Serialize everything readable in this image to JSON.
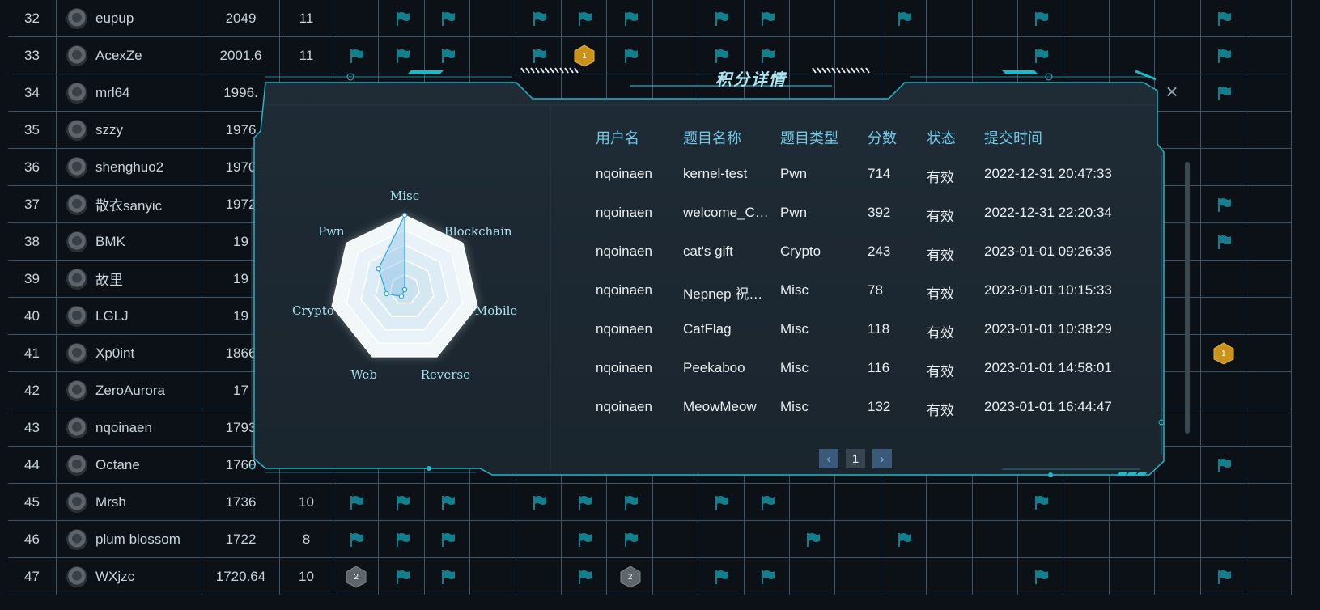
{
  "scoreboard": {
    "rows": [
      {
        "rank": "32",
        "name": "eupup",
        "score": "2049",
        "solved": "11",
        "flags": [
          1,
          2,
          4,
          5,
          6,
          8,
          9,
          12,
          15,
          19
        ]
      },
      {
        "rank": "33",
        "name": "AcexZe",
        "score": "2001.6",
        "solved": "11",
        "flags": [
          0,
          1,
          2,
          4,
          6,
          8,
          9,
          15,
          19
        ],
        "badges": [
          {
            "col": 5,
            "label": "1",
            "color": "gold"
          }
        ]
      },
      {
        "rank": "34",
        "name": "mrl64",
        "score": "1996.",
        "solved": "",
        "flags": [
          19
        ]
      },
      {
        "rank": "35",
        "name": "szzy",
        "score": "1976",
        "solved": "",
        "flags": []
      },
      {
        "rank": "36",
        "name": "shenghuo2",
        "score": "1970",
        "solved": "",
        "flags": []
      },
      {
        "rank": "37",
        "name": "散衣sanyic",
        "score": "1972",
        "solved": "",
        "flags": [
          19
        ]
      },
      {
        "rank": "38",
        "name": "BMK",
        "score": "19",
        "solved": "",
        "flags": [
          19
        ]
      },
      {
        "rank": "39",
        "name": "故里",
        "score": "19",
        "solved": "",
        "flags": []
      },
      {
        "rank": "40",
        "name": "LGLJ",
        "score": "19",
        "solved": "",
        "flags": []
      },
      {
        "rank": "41",
        "name": "Xp0int",
        "score": "1866",
        "solved": "",
        "flags": [],
        "badges": [
          {
            "col": 19,
            "label": "1",
            "color": "gold"
          }
        ]
      },
      {
        "rank": "42",
        "name": "ZeroAurora",
        "score": "17",
        "solved": "",
        "flags": []
      },
      {
        "rank": "43",
        "name": "nqoinaen",
        "score": "1793",
        "solved": "",
        "flags": []
      },
      {
        "rank": "44",
        "name": "Octane",
        "score": "1760",
        "solved": "",
        "flags": [
          19
        ]
      },
      {
        "rank": "45",
        "name": "Mrsh",
        "score": "1736",
        "solved": "10",
        "flags": [
          0,
          1,
          2,
          4,
          5,
          6,
          8,
          9,
          15
        ]
      },
      {
        "rank": "46",
        "name": "plum blossom",
        "score": "1722",
        "solved": "8",
        "flags": [
          0,
          1,
          2,
          5,
          6,
          10,
          12
        ]
      },
      {
        "rank": "47",
        "name": "WXjzc",
        "score": "1720.64",
        "solved": "10",
        "flags": [
          1,
          2,
          5,
          8,
          9,
          15,
          19
        ],
        "badges": [
          {
            "col": 0,
            "label": "2",
            "color": "gray"
          },
          {
            "col": 6,
            "label": "2",
            "color": "gray"
          }
        ]
      }
    ]
  },
  "modal": {
    "title": "积分详情",
    "close_icon": "×",
    "radar": {
      "axes": [
        "Misc",
        "Blockchain",
        "Mobile",
        "Reverse",
        "Web",
        "Crypto",
        "Pwn"
      ],
      "values": [
        1.0,
        0.0,
        0.0,
        0.0,
        0.1,
        0.25,
        0.45
      ]
    },
    "table": {
      "headers": [
        "用户名",
        "题目名称",
        "题目类型",
        "分数",
        "状态",
        "提交时间"
      ],
      "rows": [
        {
          "user": "nqoinaen",
          "challenge": "kernel-test",
          "type": "Pwn",
          "score": "714",
          "status": "有效",
          "time": "2022-12-31 20:47:33"
        },
        {
          "user": "nqoinaen",
          "challenge": "welcome_C…",
          "type": "Pwn",
          "score": "392",
          "status": "有效",
          "time": "2022-12-31 22:20:34"
        },
        {
          "user": "nqoinaen",
          "challenge": "cat's gift",
          "type": "Crypto",
          "score": "243",
          "status": "有效",
          "time": "2023-01-01 09:26:36"
        },
        {
          "user": "nqoinaen",
          "challenge": "Nepnep 祝…",
          "type": "Misc",
          "score": "78",
          "status": "有效",
          "time": "2023-01-01 10:15:33"
        },
        {
          "user": "nqoinaen",
          "challenge": "CatFlag",
          "type": "Misc",
          "score": "118",
          "status": "有效",
          "time": "2023-01-01 10:38:29"
        },
        {
          "user": "nqoinaen",
          "challenge": "Peekaboo",
          "type": "Misc",
          "score": "116",
          "status": "有效",
          "time": "2023-01-01 14:58:01"
        },
        {
          "user": "nqoinaen",
          "challenge": "MeowMeow",
          "type": "Misc",
          "score": "132",
          "status": "有效",
          "time": "2023-01-01 16:44:47"
        }
      ]
    },
    "pagination": {
      "prev": "‹",
      "page": "1",
      "next": "›"
    }
  },
  "colors": {
    "accent": "#1fb8c9",
    "flag": "#137f8c",
    "gold": "#c9921a",
    "radar_line": "#2aa7e0"
  }
}
